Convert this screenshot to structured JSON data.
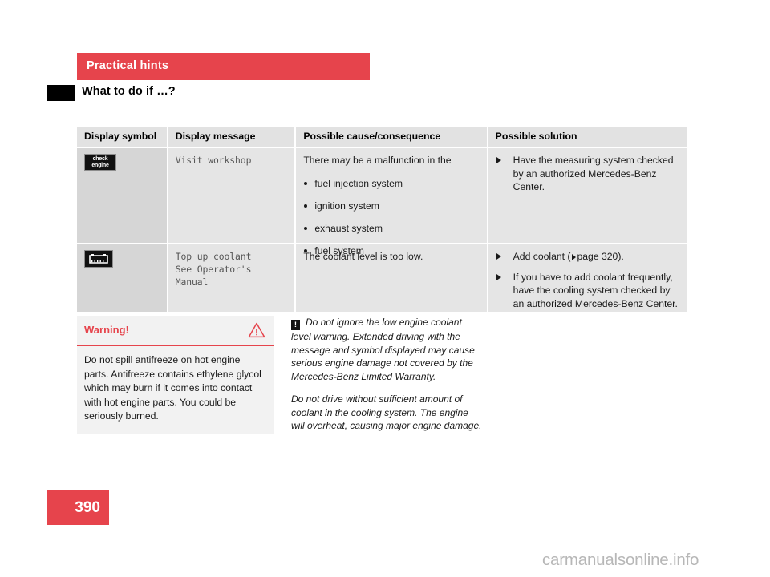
{
  "header": {
    "chapter": "Practical hints",
    "section": "What to do if …?"
  },
  "table": {
    "columns": [
      "Display symbol",
      "Display message",
      "Possible cause/consequence",
      "Possible solution"
    ],
    "rows": [
      {
        "symbol_icon": "check-engine-symbol",
        "symbol_text_line1": "check",
        "symbol_text_line2": "engine",
        "message": "Visit workshop",
        "cause_intro": "There may be a malfunction in the",
        "cause_bullets": [
          "fuel injection system",
          "ignition system",
          "exhaust system",
          "fuel system"
        ],
        "solutions": [
          {
            "text": "Have the measuring system checked by an authorized Mercedes-Benz Center."
          }
        ]
      },
      {
        "symbol_icon": "coolant-level-symbol",
        "message_line1": "Top up coolant",
        "message_line2": "See Operator's Manual",
        "cause_intro": "The coolant level is too low.",
        "cause_bullets": [],
        "solutions": [
          {
            "pre": "Add coolant (",
            "ref": "page 320",
            "post": ")."
          },
          {
            "text": "If you have to add coolant frequently, have the cooling system checked by an authorized Mercedes-Benz Center."
          }
        ]
      }
    ]
  },
  "warning": {
    "title": "Warning!",
    "icon": "warning-triangle-icon",
    "body": "Do not spill antifreeze on hot engine parts. Antifreeze contains ethylene glycol which may burn if it comes into contact with hot engine parts. You could be seriously burned."
  },
  "note": {
    "badge": "!",
    "paragraphs": [
      "Do not ignore the low engine coolant level warning. Extended driving with the message and symbol displayed may cause serious engine damage not covered by the Mercedes-Benz Limited Warranty.",
      "Do not drive without sufficient amount of coolant in the cooling system. The engine will overheat, causing major engine damage."
    ]
  },
  "folio": {
    "page_number": "390"
  },
  "watermark": {
    "text": "carmanualsonline.info"
  },
  "colors": {
    "accent_red": "#e6444c",
    "symbol_cell_gray": "#d6d6d6",
    "cell_gray": "#e5e5e5",
    "header_gray": "#e2e2e2",
    "warning_bg": "#f2f2f2"
  }
}
